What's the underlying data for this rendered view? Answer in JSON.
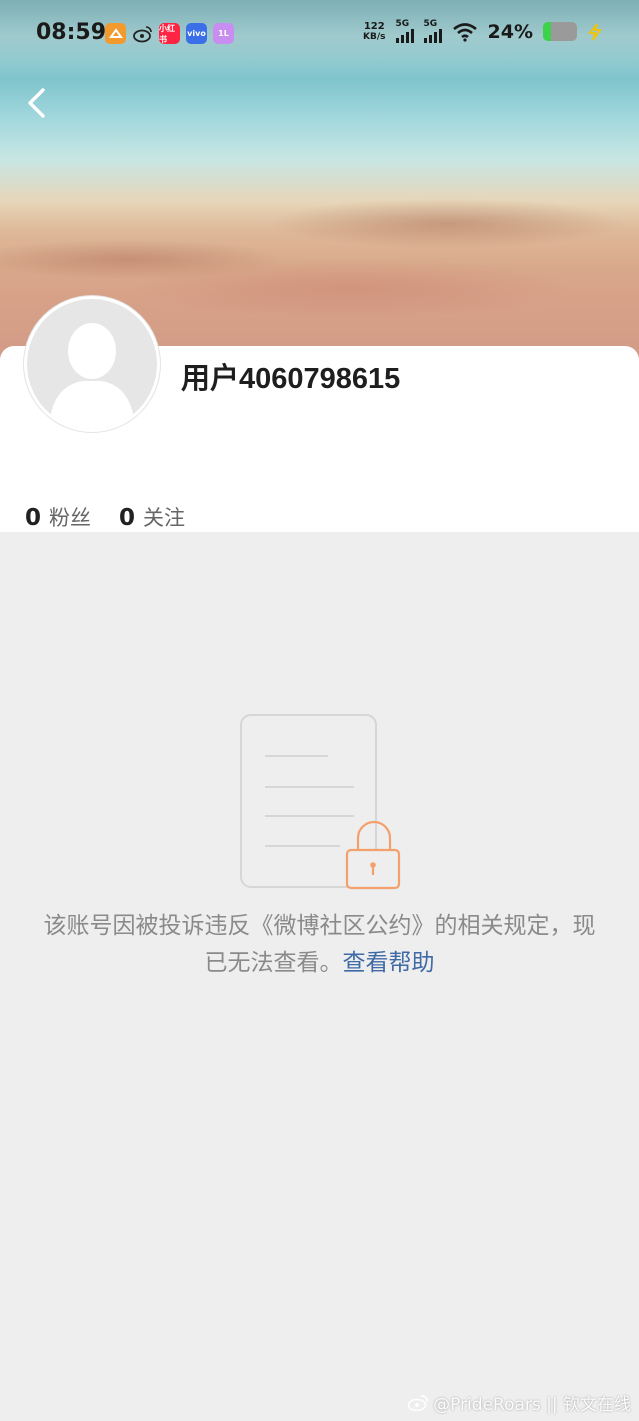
{
  "status_bar": {
    "time": "08:59",
    "net_speed_value": "122",
    "net_speed_unit": "KB/s",
    "signal1_label": "5G",
    "signal2_label": "5G",
    "battery_percent": "24%",
    "battery_level": 0.24,
    "app_icons": [
      "orange-app-icon",
      "weibo-icon",
      "red-app-icon",
      "vivo-icon",
      "purple-app-icon"
    ],
    "app_icon_texts": {
      "red": "小红书",
      "vivo": "vivo",
      "purple": "1L"
    }
  },
  "profile": {
    "username": "用户4060798615",
    "followers_count": "0",
    "followers_label": "粉丝",
    "following_count": "0",
    "following_label": "关注"
  },
  "notice": {
    "message": "该账号因被投诉违反《微博社区公约》的相关规定，现已无法查看。",
    "help_link": "查看帮助"
  },
  "watermark": {
    "text": "@PrideRoars || 钦文在线"
  },
  "colors": {
    "accent_link": "#3f6aa6",
    "lock_orange": "#f4a06c",
    "background": "#eeeeee"
  }
}
